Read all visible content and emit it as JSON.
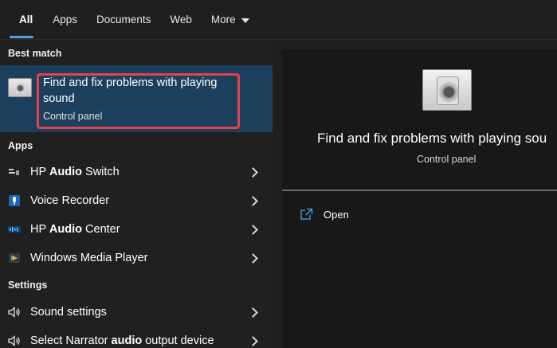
{
  "tabs": [
    {
      "label": "All",
      "active": true
    },
    {
      "label": "Apps"
    },
    {
      "label": "Documents"
    },
    {
      "label": "Web"
    },
    {
      "label": "More"
    }
  ],
  "best_match": {
    "header": "Best match",
    "title": "Find and fix problems with playing sound",
    "subtitle": "Control panel",
    "icon": "sound-troubleshooter-icon",
    "highlight_color": "#e8414c"
  },
  "apps": {
    "header": "Apps",
    "items": [
      {
        "pre": "HP ",
        "bold": "Audio",
        "post": " Switch",
        "icon": "hp-audio-switch-icon"
      },
      {
        "pre": "Voice Recorder",
        "bold": "",
        "post": "",
        "icon": "voice-recorder-icon"
      },
      {
        "pre": "HP ",
        "bold": "Audio",
        "post": " Center",
        "icon": "hp-audio-center-icon"
      },
      {
        "pre": "Windows Media Player",
        "bold": "",
        "post": "",
        "icon": "windows-media-player-icon"
      }
    ]
  },
  "settings": {
    "header": "Settings",
    "items": [
      {
        "pre": "Sound settings",
        "bold": "",
        "post": "",
        "icon": "speaker-icon"
      },
      {
        "pre": "Select Narrator ",
        "bold": "audio",
        "post": " output device",
        "icon": "speaker-icon"
      }
    ]
  },
  "preview": {
    "title": "Find and fix problems with playing sou",
    "subtitle": "Control panel",
    "open_label": "Open"
  },
  "colors": {
    "accent": "#4aa3e8",
    "selected_bg": "#1c3f5e"
  }
}
